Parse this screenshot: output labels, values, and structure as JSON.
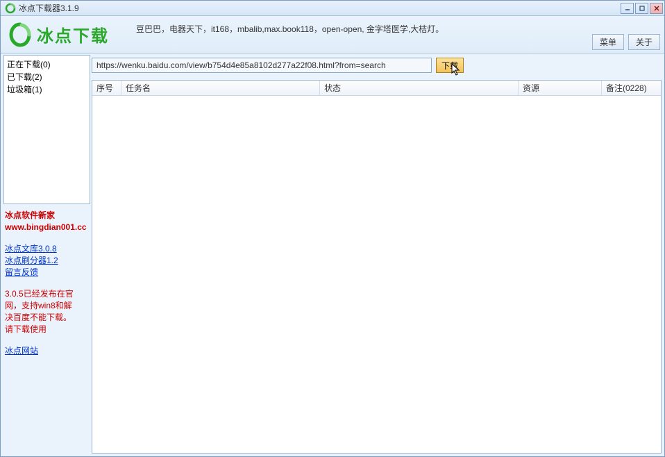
{
  "window": {
    "title": "冰点下载器3.1.9"
  },
  "header": {
    "logo_text": "冰点下载",
    "scroll_text": "豆巴巴，电器天下，it168，mbalib,max.book118，open-open, 金字塔医学,大桔灯。",
    "menu_btn": "菜单",
    "about_btn": "关于"
  },
  "url_bar": {
    "value": "https://wenku.baidu.com/view/b754d4e85a8102d277a22f08.html?from=search",
    "download_btn": "下载"
  },
  "sidebar": {
    "items": [
      "正在下载(0)",
      "已下载(2)",
      "垃圾箱(1)"
    ],
    "promo_title": "冰点软件新家",
    "promo_url": "www.bingdian001.cc",
    "links": [
      "冰点文库3.0.8",
      "冰点刷分器1.2",
      "留言反馈"
    ],
    "notice_lines": [
      "3.0.5已经发布在官",
      "网，支持win8和解",
      "决百度不能下载。",
      "请下载使用"
    ],
    "site_link": "冰点网站"
  },
  "table": {
    "columns": [
      "序号",
      "任务名",
      "状态",
      "资源",
      "备注(0228)"
    ]
  }
}
